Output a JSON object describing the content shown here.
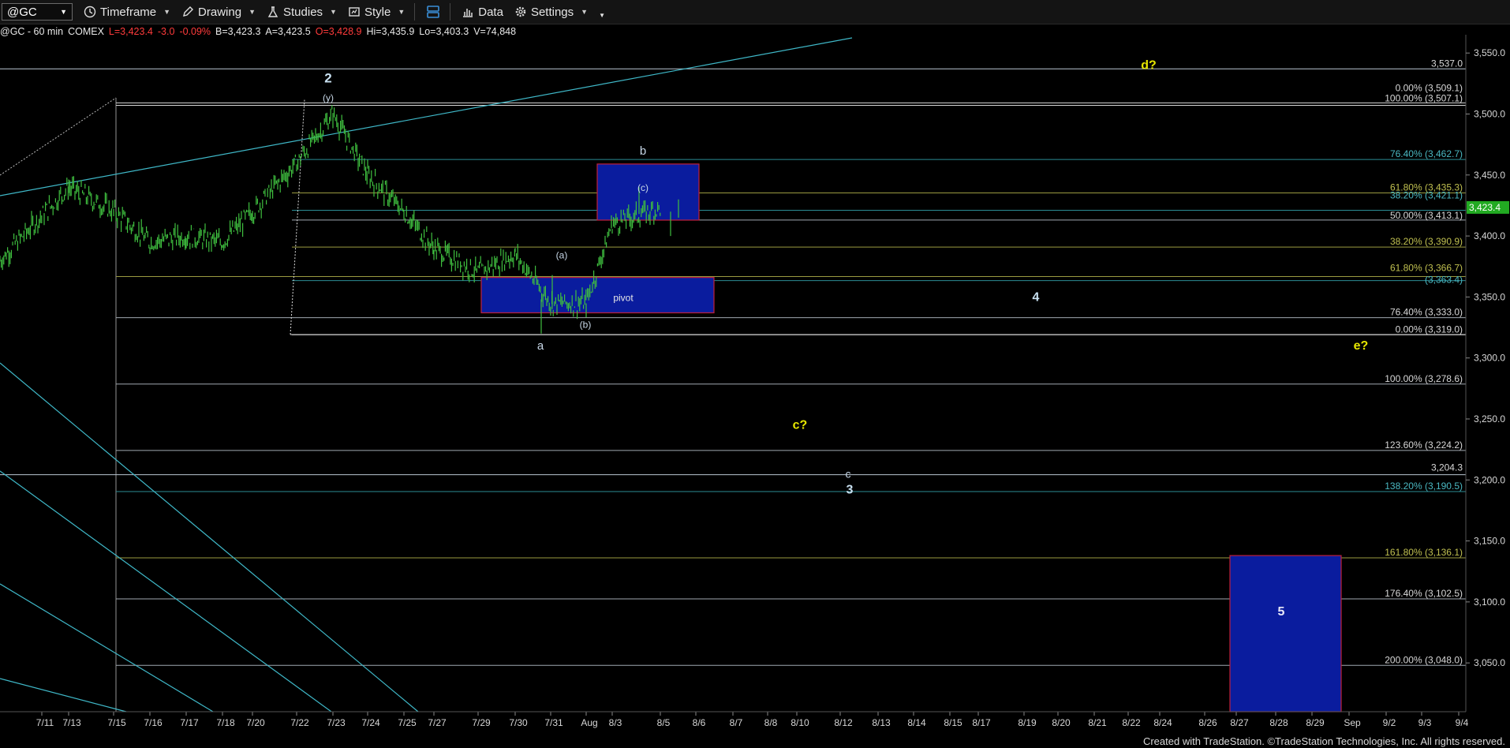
{
  "toolbar": {
    "symbol": "@GC",
    "timeframe": "Timeframe",
    "drawing": "Drawing",
    "studies": "Studies",
    "style": "Style",
    "data": "Data",
    "settings": "Settings"
  },
  "legend": {
    "instrument": "@GC - 60 min",
    "exchange": "COMEX",
    "last": "L=3,423.4",
    "change": "-3.0",
    "pct": "-0.09%",
    "bid": "B=3,423.3",
    "ask": "A=3,423.5",
    "open": "O=3,428.9",
    "high": "Hi=3,435.9",
    "low": "Lo=3,403.3",
    "volume": "V=74,848"
  },
  "footer": "Created with TradeStation. ©TradeStation Technologies, Inc. All rights reserved.",
  "colors": {
    "background": "#000000",
    "price": "#3fbf3f",
    "boxFill": "#0a1c9e",
    "boxBorder": "#c0203a",
    "trendline": "#3fb8c8",
    "label": "#c8d8e8",
    "yellow": "#e6e600",
    "lastPrice": "#22aa22"
  },
  "chart_data": {
    "type": "line",
    "title": "@GC - 60 min",
    "ylim": [
      3010,
      3565
    ],
    "yticks": [
      "3,550.0",
      "3,500.0",
      "3,450.0",
      "3,400.0",
      "3,350.0",
      "3,300.0",
      "3,250.0",
      "3,200.0",
      "3,150.0",
      "3,100.0",
      "3,050.0"
    ],
    "ytick_values": [
      3550,
      3500,
      3450,
      3400,
      3350,
      3300,
      3250,
      3200,
      3150,
      3100,
      3050
    ],
    "xticks": [
      "7/11",
      "7/13",
      "7/15",
      "7/16",
      "7/17",
      "7/18",
      "7/20",
      "7/22",
      "7/23",
      "7/24",
      "7/25",
      "7/27",
      "7/29",
      "7/30",
      "7/31",
      "Aug",
      "8/3",
      "8/5",
      "8/6",
      "8/7",
      "8/8",
      "8/10",
      "8/12",
      "8/13",
      "8/14",
      "8/15",
      "8/17",
      "8/19",
      "8/20",
      "8/21",
      "8/22",
      "8/24",
      "8/26",
      "8/27",
      "8/28",
      "8/29",
      "Sep",
      "9/2",
      "9/3",
      "9/4"
    ],
    "series": [
      {
        "x": [
          "7/11",
          "7/13",
          "7/15",
          "7/16",
          "7/17",
          "7/18",
          "7/20",
          "7/22",
          "7/23",
          "7/24",
          "7/25",
          "7/27",
          "7/29",
          "7/30",
          "7/31",
          "Aug",
          "8/3",
          "8/5"
        ],
        "values": [
          3380,
          3440,
          3420,
          3395,
          3400,
          3395,
          3420,
          3460,
          3500,
          3450,
          3420,
          3390,
          3370,
          3385,
          3345,
          3345,
          3410,
          3423
        ]
      }
    ],
    "last_price": "3,423.4",
    "last_price_value": 3423.4,
    "levels": [
      {
        "label": "3,537.0",
        "value": 3537.0
      },
      {
        "label": "100.00% (3,507.1)",
        "value": 3507.1
      },
      {
        "label": "0.00% (3,509.1)",
        "value": 3509.1
      },
      {
        "label": "76.40% (3,462.7)",
        "value": 3462.7
      },
      {
        "label": "61.80% (3,435.3)",
        "value": 3435.3
      },
      {
        "label": "38.20% (3,421.1)",
        "value": 3421.1
      },
      {
        "label": "50.00% (3,413.1)",
        "value": 3413.1
      },
      {
        "label": "38.20% (3,390.9)",
        "value": 3390.9
      },
      {
        "label": "61.80% (3,366.7)",
        "value": 3366.7
      },
      {
        "label": "(3,363.4)",
        "value": 3363.4
      },
      {
        "label": "76.40% (3,333.0)",
        "value": 3333.0
      },
      {
        "label": "0.00% (3,319.0)",
        "value": 3319.0
      },
      {
        "label": "100.00% (3,278.6)",
        "value": 3278.6
      },
      {
        "label": "123.60% (3,224.2)",
        "value": 3224.2
      },
      {
        "label": "3,204.3",
        "value": 3204.3
      },
      {
        "label": "138.20% (3,190.5)",
        "value": 3190.5
      },
      {
        "label": "161.80% (3,136.1)",
        "value": 3136.1
      },
      {
        "label": "176.40% (3,102.5)",
        "value": 3102.5
      },
      {
        "label": "200.00% (3,048.0)",
        "value": 3048.0
      }
    ],
    "annotations": [
      {
        "text": "2",
        "value": 3529
      },
      {
        "text": "(y)",
        "value": 3514
      },
      {
        "text": "b",
        "value": 3470
      },
      {
        "text": "(c)",
        "value": 3440
      },
      {
        "text": "(a)",
        "value": 3385
      },
      {
        "text": "pivot",
        "value": 3350
      },
      {
        "text": "(b)",
        "value": 3328
      },
      {
        "text": "a",
        "value": 3310
      },
      {
        "text": "4",
        "value": 3350
      },
      {
        "text": "d?",
        "value": 3540
      },
      {
        "text": "e?",
        "value": 3310
      },
      {
        "text": "c?",
        "value": 3245
      },
      {
        "text": "c",
        "value": 3205
      },
      {
        "text": "3",
        "value": 3192
      },
      {
        "text": "5",
        "value": 3092
      }
    ],
    "boxes": [
      {
        "name": "pivot",
        "top": 3366,
        "bottom": 3337
      },
      {
        "name": "b-target",
        "top": 3459,
        "bottom": 3413
      },
      {
        "name": "wave-5",
        "top": 3138,
        "bottom": 3010
      }
    ]
  }
}
